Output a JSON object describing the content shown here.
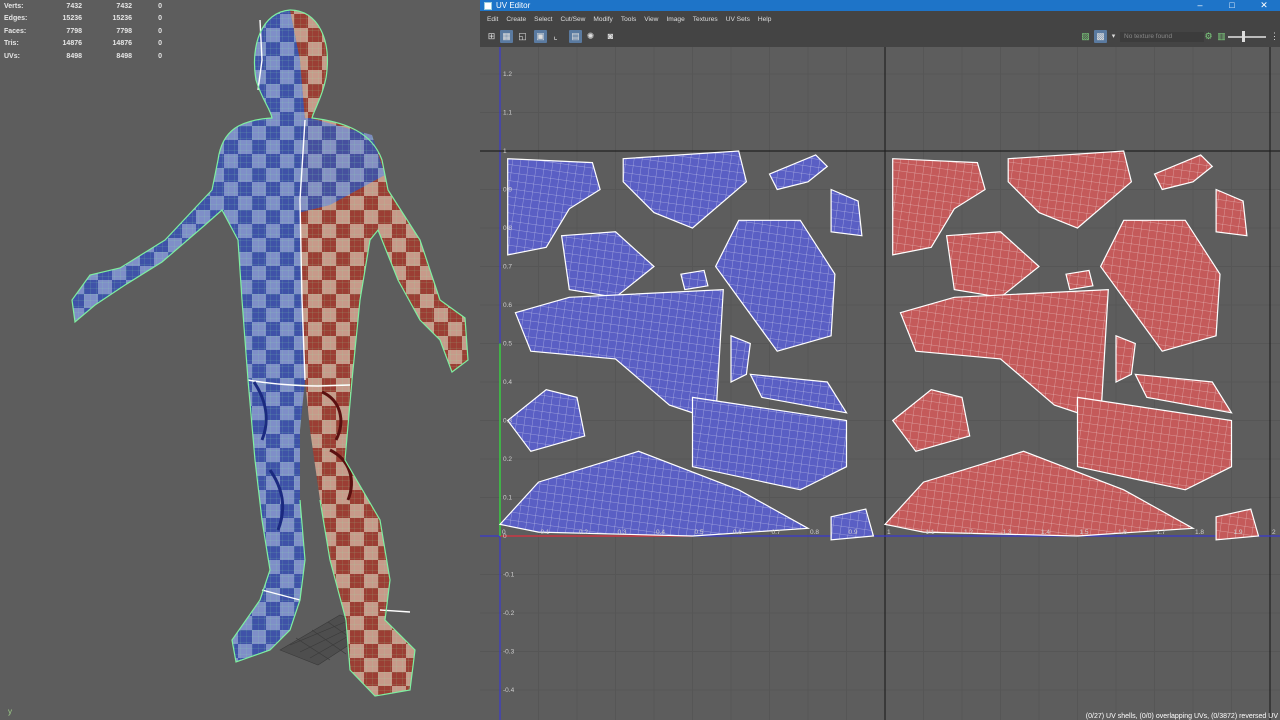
{
  "stats": {
    "rows": [
      {
        "label": "Verts:",
        "a": "7432",
        "b": "7432",
        "c": "0"
      },
      {
        "label": "Edges:",
        "a": "15236",
        "b": "15236",
        "c": "0"
      },
      {
        "label": "Faces:",
        "a": "7798",
        "b": "7798",
        "c": "0"
      },
      {
        "label": "Tris:",
        "a": "14876",
        "b": "14876",
        "c": "0"
      },
      {
        "label": "UVs:",
        "a": "8498",
        "b": "8498",
        "c": "0"
      }
    ]
  },
  "viewport": {
    "axis_label": "y"
  },
  "uv_editor": {
    "title": "UV Editor",
    "window_buttons": [
      "–",
      "□",
      "✕"
    ],
    "menu": [
      "Edit",
      "Create",
      "Select",
      "Cut/Sew",
      "Modify",
      "Tools",
      "View",
      "Image",
      "Textures",
      "UV Sets",
      "Help"
    ],
    "texture_field": "No texture found",
    "status": "(0/27) UV shells, (0/0) overlapping UVs, (0/3872) reversed UV",
    "y_ticks": [
      "1.2",
      "1.1",
      "1",
      "0.9",
      "0.8",
      "0.7",
      "0.6",
      "0.5",
      "0.4",
      "0.3",
      "0.2",
      "0.1",
      "0",
      "-0.1",
      "-0.2",
      "-0.3",
      "-0.4"
    ],
    "x_ticks": [
      "0",
      "0.1",
      "0.2",
      "0.3",
      "0.4",
      "0.5",
      "0.6",
      "0.7",
      "0.8",
      "0.9",
      "1",
      "1.1",
      "1.2",
      "1.3",
      "1.4",
      "1.5",
      "1.6",
      "1.7",
      "1.8",
      "1.9",
      "2"
    ],
    "shell_colors": {
      "left": "#5a5fc4",
      "right": "#c45a5a",
      "wire": "#ffffff"
    }
  },
  "toolbar": {
    "icons": [
      "grid-icon",
      "uv-select-icon",
      "shell-icon",
      "checker-icon",
      "frame-icon",
      "snapshot-icon",
      "camera-icon"
    ],
    "right_icons": [
      "image-icon",
      "checker-toggle-icon",
      "settings-icon",
      "layers-icon"
    ]
  }
}
